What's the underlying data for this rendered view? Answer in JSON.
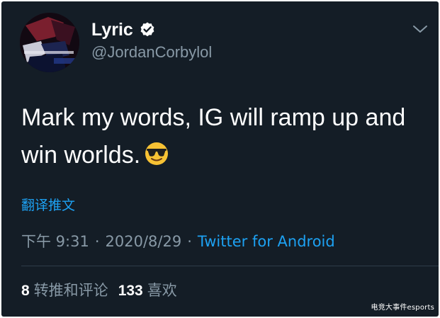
{
  "author": {
    "display_name": "Lyric",
    "handle": "@JordanCorbylol",
    "verified_icon": "verified-badge-icon"
  },
  "menu_icon": "chevron-down-icon",
  "tweet": {
    "text": "Mark my words, IG will ramp up and win worlds.",
    "emoji": "smiling-face-with-sunglasses"
  },
  "translate_label": "翻译推文",
  "meta": {
    "time": "下午 9:31",
    "separator": "·",
    "date": "2020/8/29",
    "source": "Twitter for Android"
  },
  "stats": {
    "retweets_count": "8",
    "retweets_label": "转推和评论",
    "likes_count": "133",
    "likes_label": "喜欢"
  },
  "watermark": "电竞大事件esports",
  "colors": {
    "background": "#141d26",
    "accent": "#1da1f2",
    "secondary_text": "#8899a6",
    "divider": "#2f3d4a"
  }
}
